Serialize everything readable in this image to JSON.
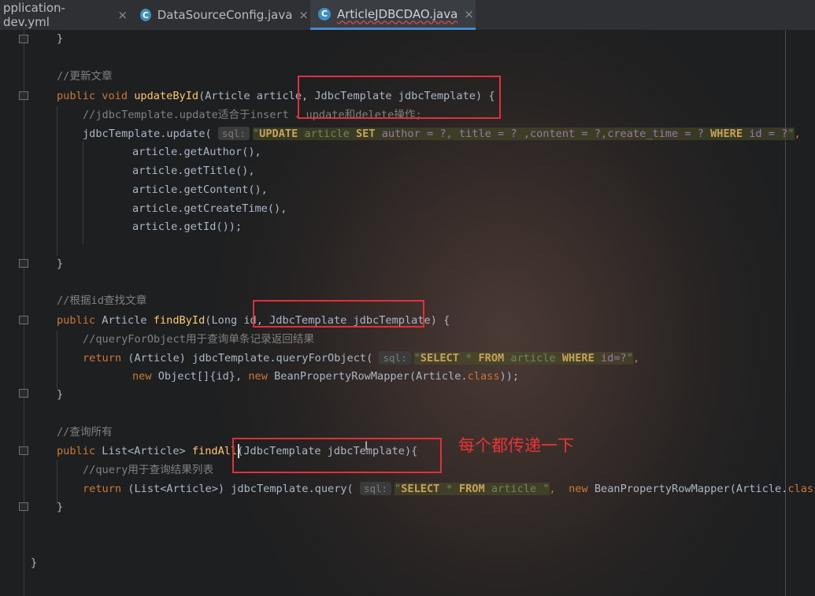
{
  "tabs": [
    {
      "label": "pplication-dev.yml",
      "active": false
    },
    {
      "label": "DataSourceConfig.java",
      "active": false,
      "icon": "class-c-icon"
    },
    {
      "label": "ArticleJDBCDAO.java",
      "active": true,
      "icon": "class-c-icon"
    }
  ],
  "tab_close": "×",
  "class_icon_letter": "C",
  "code": {
    "l1": "}",
    "comment_update": "//更新文章",
    "update_sig": {
      "kw": "public void ",
      "name": "updateById",
      "params": "(Article article, JdbcTemplate jdbcTemplate) {"
    },
    "update_comment": "//jdbcTemplate.update适合于insert 、update和delete操作;",
    "update_call": {
      "pre": "jdbcTemplate.update( ",
      "hint": "sql:",
      "q": "\"",
      "kw1": "UPDATE",
      "t1": " article ",
      "kw2": "SET",
      "t2": " author = ?, title = ? ,content = ?,create_time = ? ",
      "kw3": "WHERE",
      "t3": " id = ?",
      "q2": "\"",
      "tail": ","
    },
    "arg_author": "article.getAuthor(),",
    "arg_title": "article.getTitle(),",
    "arg_content": "article.getContent(),",
    "arg_create": "article.getCreateTime(),",
    "arg_id": "article.getId());",
    "close1": "}",
    "comment_find": "//根据id查找文章",
    "find_sig": {
      "kw": "public ",
      "type": "Article ",
      "name": "findById",
      "params": "(Long id, JdbcTemplate jdbcTemplate) {"
    },
    "find_comment": "//queryForObject用于查询单条记录返回结果",
    "find_call": {
      "ret": "return ",
      "cast": "(Article) jdbcTemplate.queryForObject( ",
      "hint": "sql:",
      "q": "\"",
      "kw1": "SELECT",
      "t1": " * ",
      "kw2": "FROM",
      "t2": " article ",
      "kw3": "WHERE",
      "t3": " id=?",
      "q2": "\"",
      "tail": ","
    },
    "find_args": {
      "kw": "new ",
      "a": "Object[]{id}, ",
      "kw2": "new ",
      "b": "BeanPropertyRowMapper(Article.",
      "kw3": "class",
      "c": "));"
    },
    "close2": "}",
    "comment_all": "//查询所有",
    "all_sig": {
      "kw": "public ",
      "type": "List<Article> ",
      "name": "findAll",
      "params": "(JdbcTemplate jdbcTemplate){"
    },
    "all_comment": "//query用于查询结果列表",
    "all_call": {
      "ret": "return ",
      "cast": "(List<Article>) jdbcTemplate.query( ",
      "hint": "sql:",
      "q": "\"",
      "kw1": "SELECT",
      "t1": " * ",
      "kw2": "FROM",
      "t2": " article ",
      "q2": "\"",
      "tail": ",  ",
      "kw3": "new ",
      "b": "BeanPropertyRowMapper(Article.",
      "kw4": "class",
      "c": "))"
    },
    "close3": "}",
    "close_class": "}"
  },
  "annotation": "每个都传递一下",
  "colors": {
    "highlight_box": "#e0303a",
    "keyword": "#cc7832",
    "method": "#ffc66d",
    "comment": "#808080"
  }
}
